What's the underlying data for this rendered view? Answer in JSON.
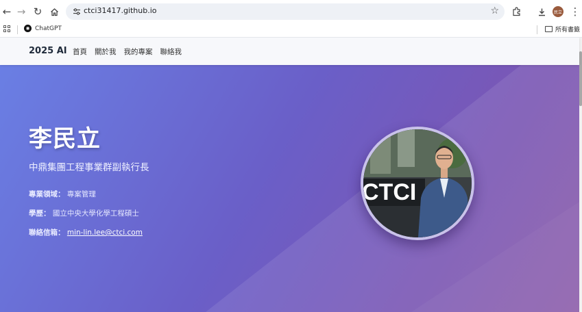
{
  "browser": {
    "url": "ctci31417.github.io",
    "avatar_text": "民立",
    "bookmarks": [
      {
        "label": "ChatGPT"
      }
    ],
    "all_bookmarks_label": "所有書籤"
  },
  "site": {
    "brand": "2025 AI",
    "nav": [
      {
        "label": "首頁"
      },
      {
        "label": "關於我"
      },
      {
        "label": "我的專案"
      },
      {
        "label": "聯絡我"
      }
    ]
  },
  "hero": {
    "name": "李民立",
    "title": "中鼎集團工程事業群副執行長",
    "field_label": "專業領域：",
    "field_value": "專案管理",
    "education_label": "學歷：",
    "education_value": "國立中央大學化學工程碩士",
    "email_label": "聯絡信箱：",
    "email_value": "min-lin.lee@ctci.com",
    "portrait_sign_text": "CTCI"
  },
  "colors": {
    "hero_start": "#6a7fe4",
    "hero_end": "#8a5aa8",
    "nav_bg": "#f7f8fb",
    "portrait_border": "#c9c2ea"
  }
}
